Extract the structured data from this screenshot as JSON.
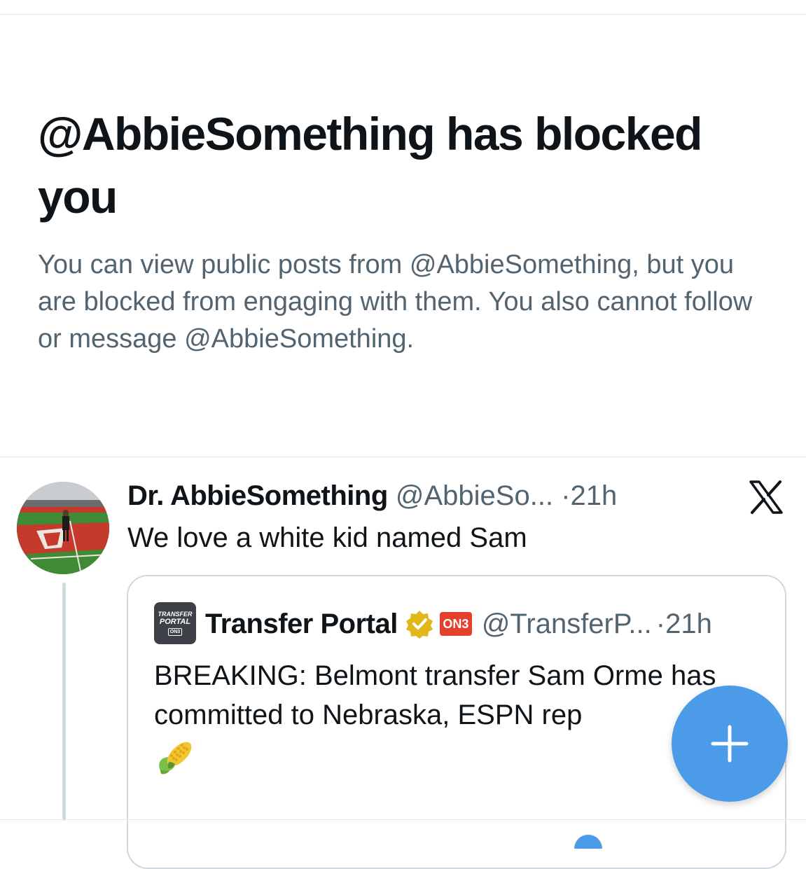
{
  "blocked_notice": {
    "title": "@AbbieSomething has blocked you",
    "description": "You can view public posts from @AbbieSomething, but you are blocked from engaging with them. You also cannot follow or message @AbbieSomething."
  },
  "tweet": {
    "display_name": "Dr. AbbieSomething",
    "handle": "@AbbieSo...",
    "separator": "·",
    "time": "21h",
    "text": "We love a white kid named Sam",
    "source_icon": "x-logo-icon"
  },
  "quoted_tweet": {
    "avatar_lines": [
      "TRANSFER",
      "PORTAL",
      "ON3"
    ],
    "display_name": "Transfer Portal",
    "affiliate_badge": "ON3",
    "handle": "@TransferP...",
    "separator": "·",
    "time": "21h",
    "text": "BREAKING: Belmont transfer Sam Orme has committed to Nebraska, ESPN rep",
    "emoji": "corn-icon"
  },
  "fab": {
    "icon": "plus-icon"
  },
  "colors": {
    "text_primary": "#0f1419",
    "text_secondary": "#536471",
    "accent_blue": "#4c9be8",
    "verified_gold": "#e2b719",
    "on3_red": "#e4402c"
  }
}
